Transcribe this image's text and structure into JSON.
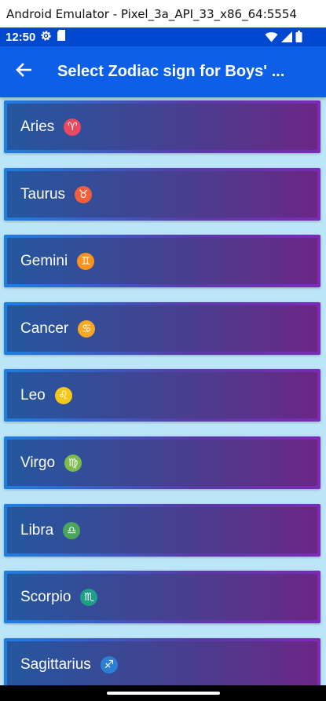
{
  "window": {
    "title": "Android Emulator - Pixel_3a_API_33_x86_64:5554"
  },
  "status_bar": {
    "time": "12:50",
    "icons": [
      "gear-icon",
      "sd-card-icon",
      "wifi-icon",
      "signal-icon",
      "battery-icon"
    ]
  },
  "app_bar": {
    "back_icon": "arrow-left-icon",
    "title": "Select Zodiac sign for Boys' ..."
  },
  "zodiac_signs": [
    {
      "name": "Aries",
      "symbol": "♈",
      "badge_color": "#e84a5f"
    },
    {
      "name": "Taurus",
      "symbol": "♉",
      "badge_color": "#f0603c"
    },
    {
      "name": "Gemini",
      "symbol": "♊",
      "badge_color": "#f7931e"
    },
    {
      "name": "Cancer",
      "symbol": "♋",
      "badge_color": "#f7a823"
    },
    {
      "name": "Leo",
      "symbol": "♌",
      "badge_color": "#f2c81a"
    },
    {
      "name": "Virgo",
      "symbol": "♍",
      "badge_color": "#7cbb4c"
    },
    {
      "name": "Libra",
      "symbol": "♎",
      "badge_color": "#4aa65a"
    },
    {
      "name": "Scorpio",
      "symbol": "♏",
      "badge_color": "#1f9e8a"
    },
    {
      "name": "Sagittarius",
      "symbol": "♐",
      "badge_color": "#2d7fd6"
    }
  ]
}
